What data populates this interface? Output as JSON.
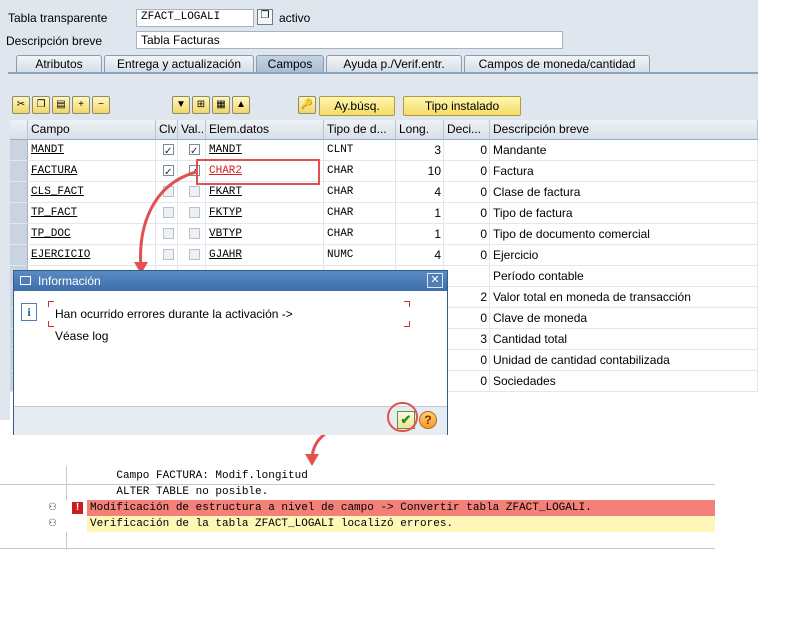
{
  "header": {
    "table_label": "Tabla transparente",
    "table_value": "ZFACT_LOGALI",
    "status": "activo",
    "desc_label": "Descripción breve",
    "desc_value": "Tabla Facturas"
  },
  "tabs": [
    {
      "label": "Atributos",
      "active": false
    },
    {
      "label": "Entrega y actualización",
      "active": false
    },
    {
      "label": "Campos",
      "active": true
    },
    {
      "label": "Ayuda p./Verif.entr.",
      "active": false
    },
    {
      "label": "Campos de moneda/cantidad",
      "active": false
    }
  ],
  "toolbar": {
    "icons": [
      "cut-icon",
      "copy-icon",
      "paste-icon",
      "insert-row-icon",
      "delete-row-icon",
      "sort-icon",
      "new-rows-icon",
      "table-icon",
      "up-icon",
      "search-help-icon"
    ],
    "search_help_label": "Ay.búsq.",
    "builtin_type_label": "Tipo instalado"
  },
  "columns": [
    "Campo",
    "Clv",
    "Val...",
    "Elem.datos",
    "Tipo de d...",
    "Long.",
    "Deci...",
    "Descripción breve"
  ],
  "rows": [
    {
      "campo": "MANDT",
      "clv": true,
      "val": true,
      "elem": "MANDT",
      "tipo": "CLNT",
      "long": "3",
      "dec": "0",
      "desc": "Mandante"
    },
    {
      "campo": "FACTURA",
      "clv": true,
      "val": true,
      "elem": "CHAR2",
      "tipo": "CHAR",
      "long": "10",
      "dec": "0",
      "desc": "Factura"
    },
    {
      "campo": "CLS_FACT",
      "clv": false,
      "val": false,
      "elem": "FKART",
      "tipo": "CHAR",
      "long": "4",
      "dec": "0",
      "desc": "Clase de factura"
    },
    {
      "campo": "TP_FACT",
      "clv": false,
      "val": false,
      "elem": "FKTYP",
      "tipo": "CHAR",
      "long": "1",
      "dec": "0",
      "desc": "Tipo de factura"
    },
    {
      "campo": "TP_DOC",
      "clv": false,
      "val": false,
      "elem": "VBTYP",
      "tipo": "CHAR",
      "long": "1",
      "dec": "0",
      "desc": "Tipo de documento comercial"
    },
    {
      "campo": "EJERCICIO",
      "clv": false,
      "val": false,
      "elem": "GJAHR",
      "tipo": "NUMC",
      "long": "4",
      "dec": "0",
      "desc": "Ejercicio"
    },
    {
      "campo": "",
      "clv": false,
      "val": false,
      "elem": "",
      "tipo": "",
      "long": "",
      "dec": "",
      "desc": "Período contable"
    },
    {
      "campo": "",
      "clv": false,
      "val": false,
      "elem": "",
      "tipo": "",
      "long": "",
      "dec": "2",
      "desc": "Valor total en moneda de transacción"
    },
    {
      "campo": "",
      "clv": false,
      "val": false,
      "elem": "",
      "tipo": "",
      "long": "",
      "dec": "0",
      "desc": "Clave de moneda"
    },
    {
      "campo": "",
      "clv": false,
      "val": false,
      "elem": "",
      "tipo": "",
      "long": "",
      "dec": "3",
      "desc": "Cantidad total"
    },
    {
      "campo": "",
      "clv": false,
      "val": false,
      "elem": "",
      "tipo": "",
      "long": "",
      "dec": "0",
      "desc": "Unidad de cantidad contabilizada"
    },
    {
      "campo": "",
      "clv": false,
      "val": false,
      "elem": "",
      "tipo": "",
      "long": "",
      "dec": "0",
      "desc": "Sociedades"
    }
  ],
  "dialog": {
    "title": "Información",
    "line1": "Han ocurrido errores durante la activación ->",
    "line2": "Véase log"
  },
  "log": [
    {
      "text": "    Campo FACTURA: Modif.longitud",
      "type": "normal"
    },
    {
      "text": "    ALTER TABLE no posible.",
      "type": "normal"
    },
    {
      "text": "Modificación de estructura a nivel de campo -> Convertir tabla ZFACT_LOGALI.",
      "type": "error"
    },
    {
      "text": "Verificación de la tabla ZFACT_LOGALI localizó errores.",
      "type": "warning"
    }
  ],
  "colors": {
    "accent": "#e35050",
    "dialog_title": "#3d6ea9",
    "error_row": "#f4807a",
    "warning_row": "#fff7b8"
  }
}
